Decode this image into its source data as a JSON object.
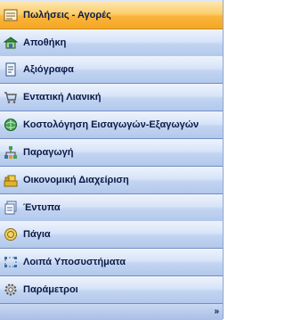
{
  "nav": {
    "items": [
      {
        "label": "Πωλήσεις - Αγορές",
        "icon": "sales-purchases-icon",
        "active": true
      },
      {
        "label": "Αποθήκη",
        "icon": "warehouse-icon"
      },
      {
        "label": "Αξιόγραφα",
        "icon": "securities-icon"
      },
      {
        "label": "Εντατική Λιανική",
        "icon": "retail-cart-icon"
      },
      {
        "label": "Κοστολόγηση Εισαγωγών-Εξαγωγών",
        "icon": "import-export-costing-icon"
      },
      {
        "label": "Παραγωγή",
        "icon": "production-icon"
      },
      {
        "label": "Οικονομική Διαχείριση",
        "icon": "financial-management-icon"
      },
      {
        "label": "Έντυπα",
        "icon": "forms-icon"
      },
      {
        "label": "Πάγια",
        "icon": "fixed-assets-icon"
      },
      {
        "label": "Λοιπά Υποσυστήματα",
        "icon": "other-subsystems-icon"
      },
      {
        "label": "Παράμετροι",
        "icon": "parameters-gear-icon"
      }
    ],
    "footer_glyph": "»"
  },
  "colors": {
    "active_item": "#f8b53c",
    "item_base": "#c2d4f1",
    "text": "#0b1a46",
    "border": "#6f8fc4"
  }
}
